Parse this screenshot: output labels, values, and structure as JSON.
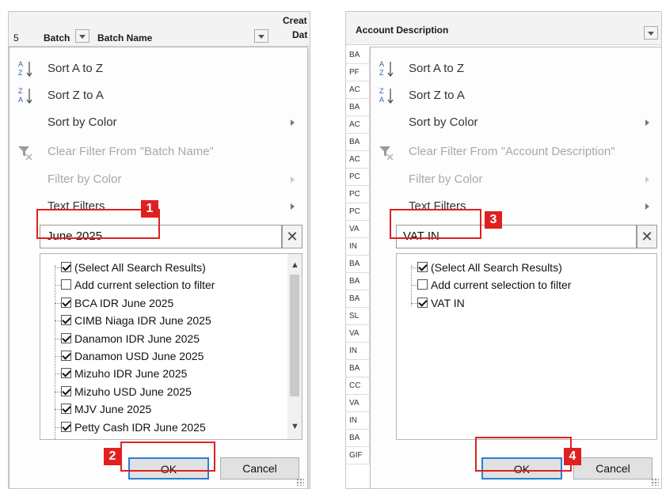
{
  "left": {
    "header": {
      "row_number": "5",
      "col1": "Batch",
      "col2": "Batch Name",
      "col3_line1": "Creat",
      "col3_line2": "Dat"
    },
    "menu": {
      "sort_az": "Sort A to Z",
      "sort_za": "Sort Z to A",
      "sort_color": "Sort by Color",
      "clear_filter": "Clear Filter From \"Batch Name\"",
      "filter_color": "Filter by Color",
      "text_filters": "Text Filters"
    },
    "search": {
      "value": "June 2025"
    },
    "list": [
      {
        "label": "(Select All Search Results)",
        "checked": true
      },
      {
        "label": "Add current selection to filter",
        "checked": false
      },
      {
        "label": "BCA IDR June 2025",
        "checked": true
      },
      {
        "label": "CIMB Niaga IDR June 2025",
        "checked": true
      },
      {
        "label": "Danamon IDR June 2025",
        "checked": true
      },
      {
        "label": "Danamon USD June 2025",
        "checked": true
      },
      {
        "label": "Mizuho IDR June 2025",
        "checked": true
      },
      {
        "label": "Mizuho USD June 2025",
        "checked": true
      },
      {
        "label": "MJV June 2025",
        "checked": true
      },
      {
        "label": "Petty Cash IDR June 2025",
        "checked": true
      }
    ],
    "ok": "OK",
    "cancel": "Cancel",
    "callouts": [
      "1",
      "2"
    ]
  },
  "right": {
    "header": {
      "col": "Account Description"
    },
    "row_cells": [
      "BA",
      "PF",
      "AC",
      "BA",
      "AC",
      "BA",
      "AC",
      "PC",
      "PC",
      "PC",
      "VA",
      "IN",
      "BA",
      "BA",
      "BA",
      "SL",
      "VA",
      "IN",
      "BA",
      "CC",
      "VA",
      "IN",
      "BA",
      "GIF"
    ],
    "menu": {
      "sort_az": "Sort A to Z",
      "sort_za": "Sort Z to A",
      "sort_color": "Sort by Color",
      "clear_filter": "Clear Filter From \"Account Description\"",
      "filter_color": "Filter by Color",
      "text_filters": "Text Filters"
    },
    "search": {
      "value": "VAT IN"
    },
    "list": [
      {
        "label": "(Select All Search Results)",
        "checked": true
      },
      {
        "label": "Add current selection to filter",
        "checked": false
      },
      {
        "label": "VAT IN",
        "checked": true
      }
    ],
    "ok": "OK",
    "cancel": "Cancel",
    "callouts": [
      "3",
      "4"
    ]
  },
  "icons": [
    "sort-az-icon",
    "sort-za-icon",
    "clear-filter-icon",
    "submenu-arrow-icon",
    "checkbox-icon",
    "close-icon",
    "chevron-up-icon",
    "chevron-down-icon"
  ],
  "colors": {
    "callout": "#e02020",
    "default_button_border": "#2a7fd4"
  }
}
